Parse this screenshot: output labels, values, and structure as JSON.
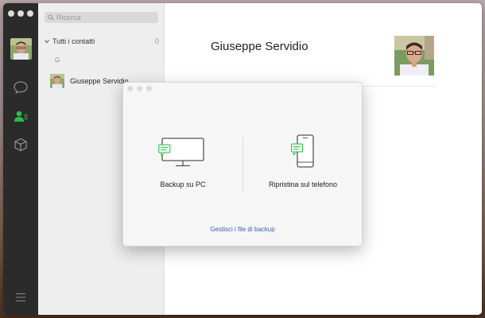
{
  "search": {
    "placeholder": "Ricerca"
  },
  "contacts": {
    "group_label": "Tutti i contatti",
    "group_count": "0",
    "section_letter": "G",
    "items": [
      {
        "name": "Giuseppe Servidio"
      }
    ]
  },
  "main": {
    "contact_name": "Giuseppe Servidio"
  },
  "dialog": {
    "backup_label": "Backup su PC",
    "restore_label": "Ripristina sul telefono",
    "manage_link": "Gestisci i file di backup"
  },
  "colors": {
    "accent": "#2bbd43",
    "link": "#3a62a5",
    "rail": "#2b2b2b"
  }
}
